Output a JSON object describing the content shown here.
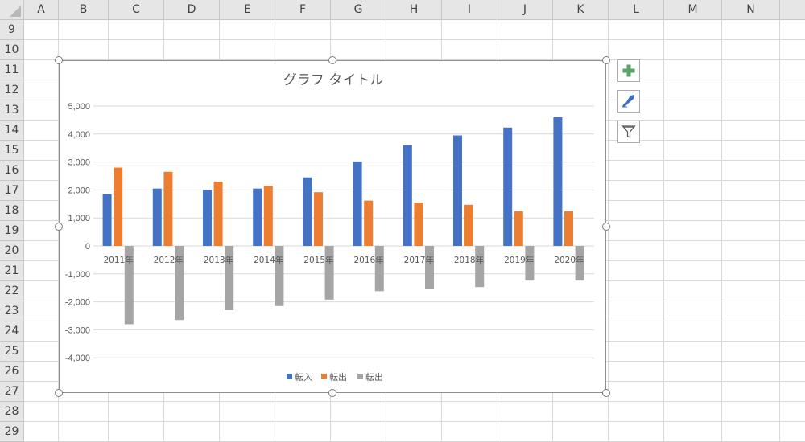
{
  "sheet": {
    "columns": [
      "A",
      "B",
      "C",
      "D",
      "E",
      "F",
      "G",
      "H",
      "I",
      "J",
      "K",
      "L",
      "M",
      "N"
    ],
    "rows": [
      "9",
      "10",
      "11",
      "12",
      "13",
      "14",
      "15",
      "16",
      "17",
      "18",
      "19",
      "20",
      "21",
      "22",
      "23",
      "24",
      "25",
      "26",
      "27",
      "28",
      "29"
    ]
  },
  "chart_buttons": {
    "elements": "plus-icon",
    "styles": "brush-icon",
    "filters": "funnel-icon"
  },
  "chart_data": {
    "type": "bar",
    "title": "グラフ タイトル",
    "categories": [
      "2011年",
      "2012年",
      "2013年",
      "2014年",
      "2015年",
      "2016年",
      "2017年",
      "2018年",
      "2019年",
      "2020年"
    ],
    "series": [
      {
        "name": "転入",
        "color": "#4472c4",
        "values": [
          1850,
          2050,
          2000,
          2050,
          2450,
          3020,
          3600,
          3950,
          4230,
          4600
        ]
      },
      {
        "name": "転出",
        "color": "#ed7d31",
        "values": [
          2800,
          2650,
          2300,
          2150,
          1920,
          1620,
          1550,
          1470,
          1240,
          1240
        ]
      },
      {
        "name": "転出",
        "color": "#a5a5a5",
        "values": [
          -2800,
          -2650,
          -2300,
          -2150,
          -1920,
          -1620,
          -1550,
          -1470,
          -1240,
          -1240
        ]
      }
    ],
    "ylim": [
      -5000,
      5000
    ],
    "yticks": [
      "5,000",
      "4,000",
      "3,000",
      "2,000",
      "1,000",
      "0",
      "-1,000",
      "-2,000",
      "-3,000",
      "-4,000"
    ],
    "ytick_values": [
      5000,
      4000,
      3000,
      2000,
      1000,
      0,
      -1000,
      -2000,
      -3000,
      -4000
    ],
    "grid": true,
    "legend_position": "bottom"
  }
}
